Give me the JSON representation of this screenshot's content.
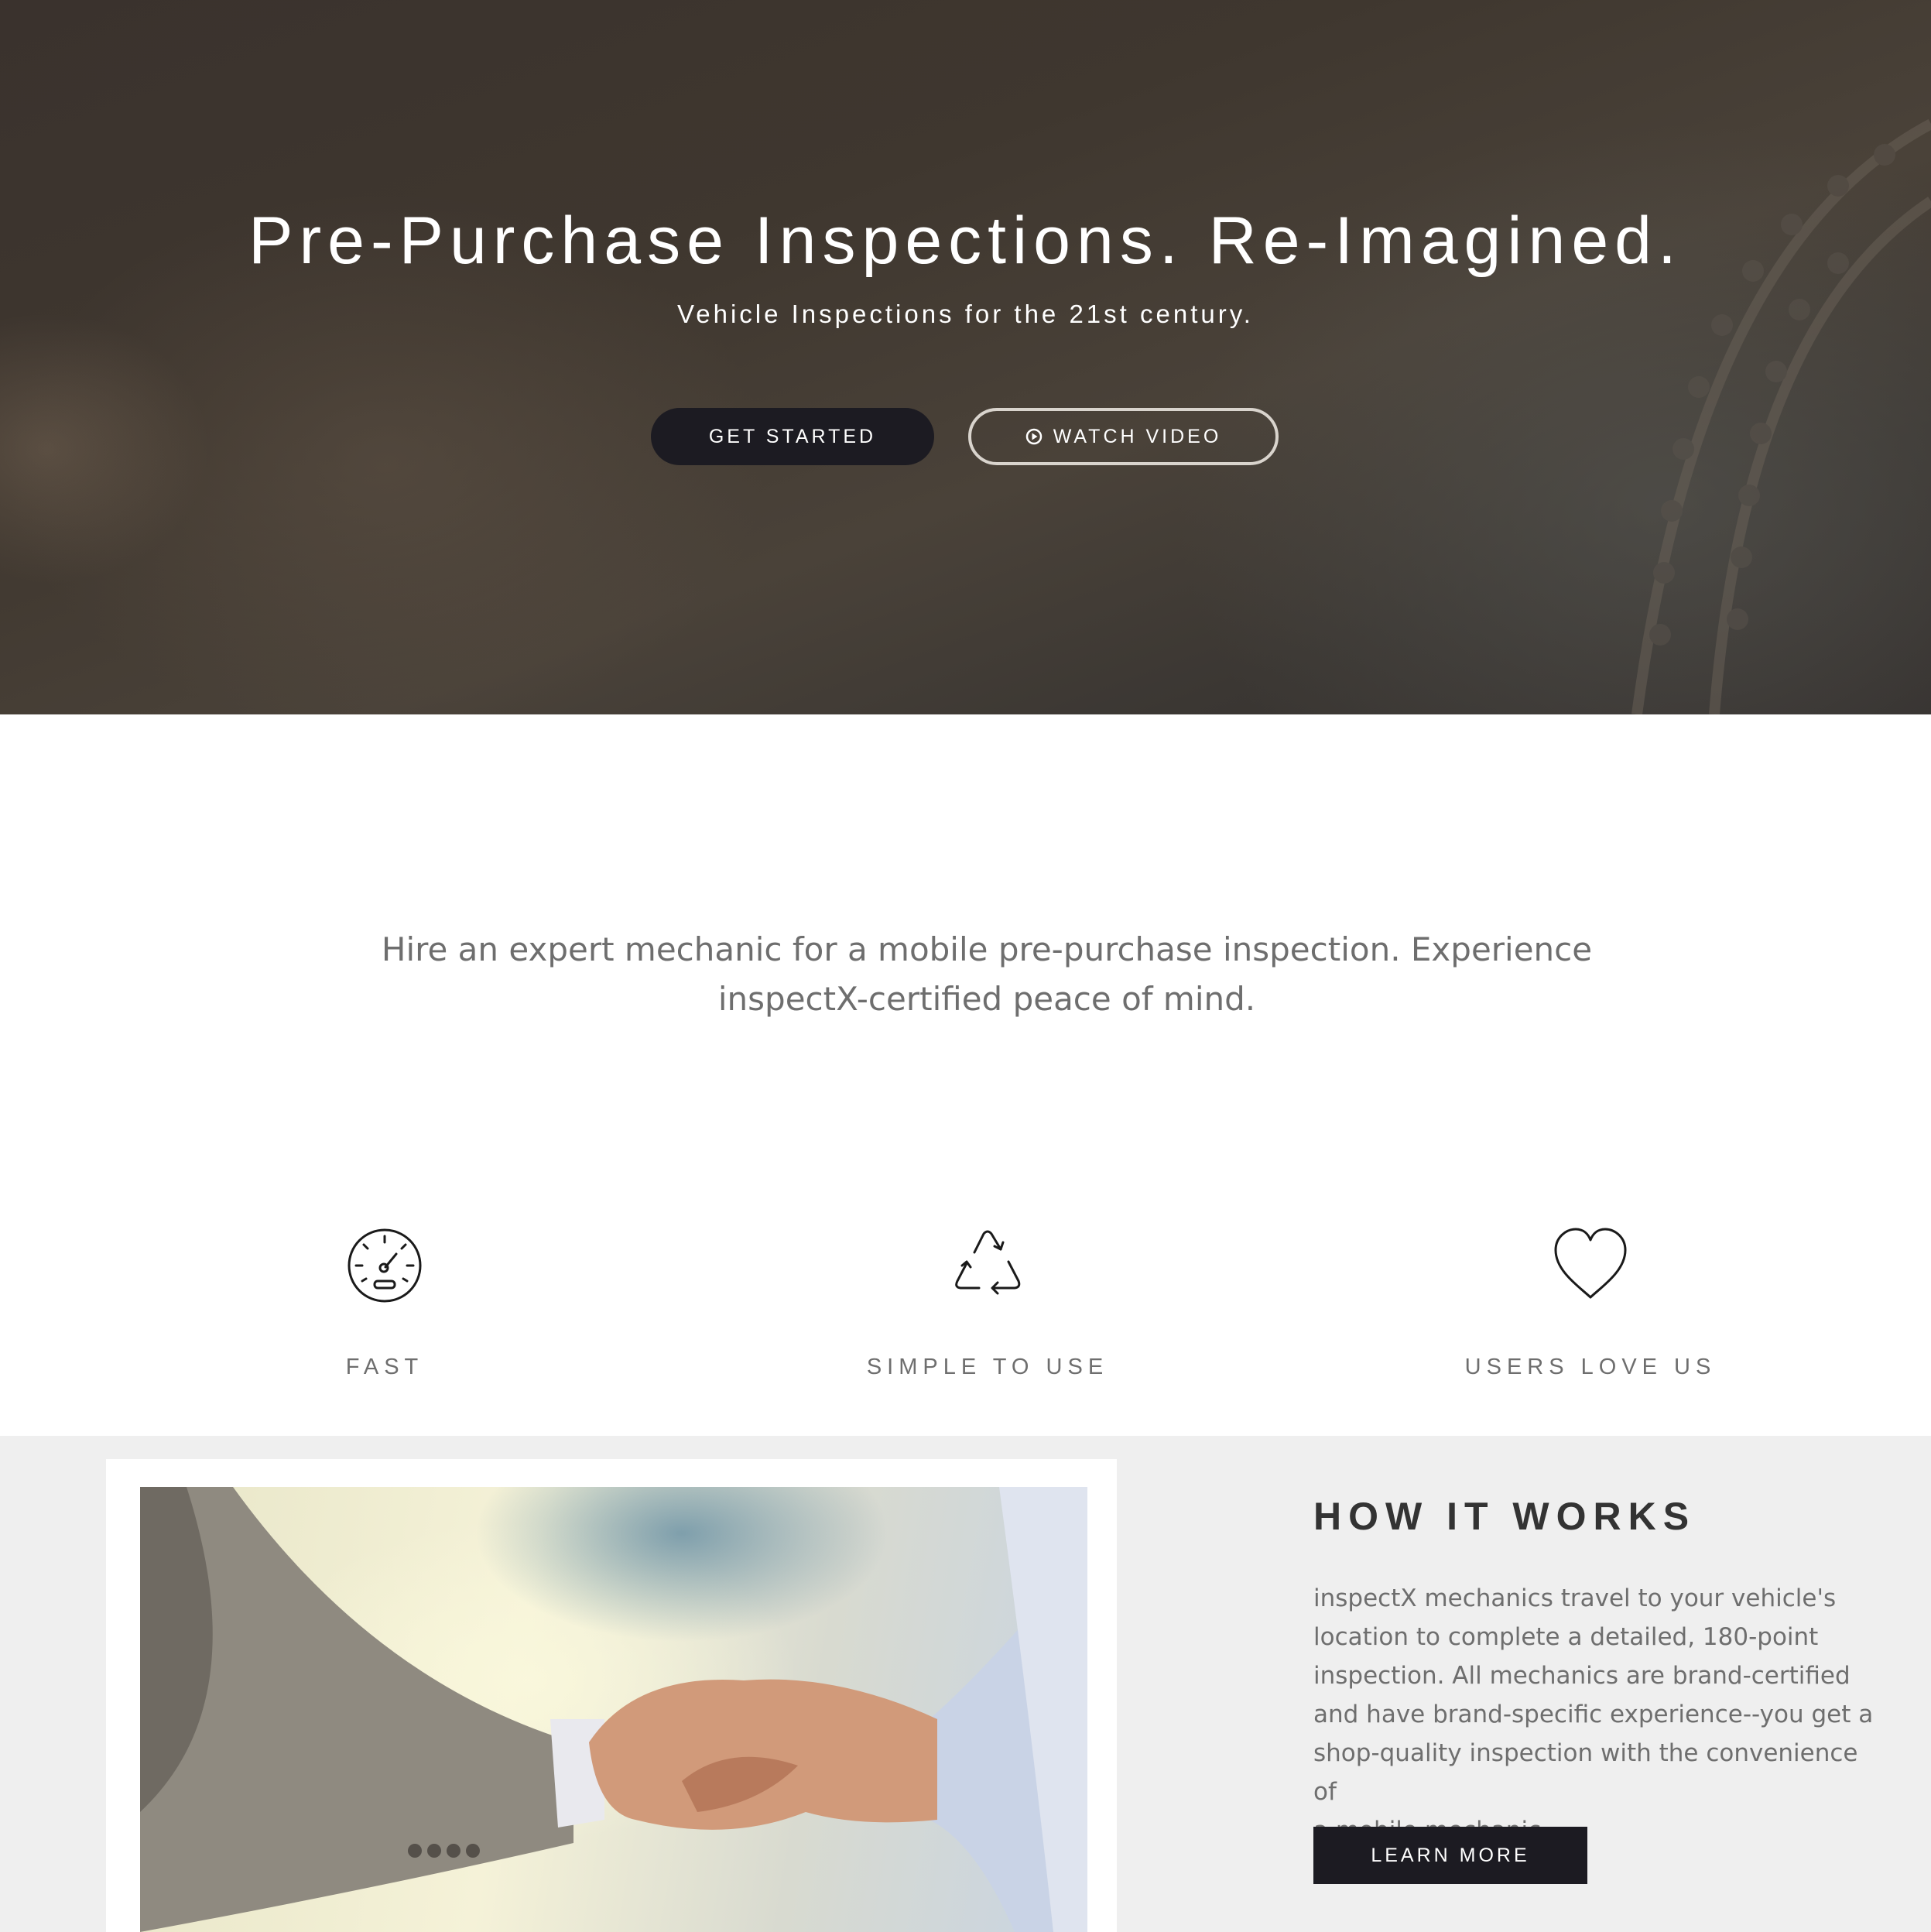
{
  "hero": {
    "title": "Pre-Purchase Inspections. Re-Imagined.",
    "subtitle": "Vehicle Inspections for the 21st century.",
    "get_started_label": "GET STARTED",
    "watch_video_label": "WATCH VIDEO",
    "watch_video_icon": "play-circle-icon"
  },
  "intro": {
    "text_line1": "Hire an expert mechanic for a mobile pre-purchase inspection. Experience",
    "text_line2": "inspectX-certified peace of mind."
  },
  "features": [
    {
      "icon": "speedometer-icon",
      "label": "FAST"
    },
    {
      "icon": "recycle-icon",
      "label": "SIMPLE TO USE"
    },
    {
      "icon": "heart-icon",
      "label": "USERS LOVE US"
    }
  ],
  "how_it_works": {
    "title": "HOW IT WORKS",
    "lines": [
      "inspectX mechanics travel to your vehicle's",
      "location to complete a detailed, 180-point",
      "inspection. All mechanics are brand-certified",
      "and have brand-specific experience--you get a",
      "shop-quality inspection with the convenience of",
      "a mobile mechanic."
    ],
    "learn_more_label": "LEARN MORE",
    "photo": "handshake-photo"
  },
  "colors": {
    "dark_button": "#1c1b22",
    "text_gray": "#6e6e6e",
    "section_bg": "#efefef"
  }
}
